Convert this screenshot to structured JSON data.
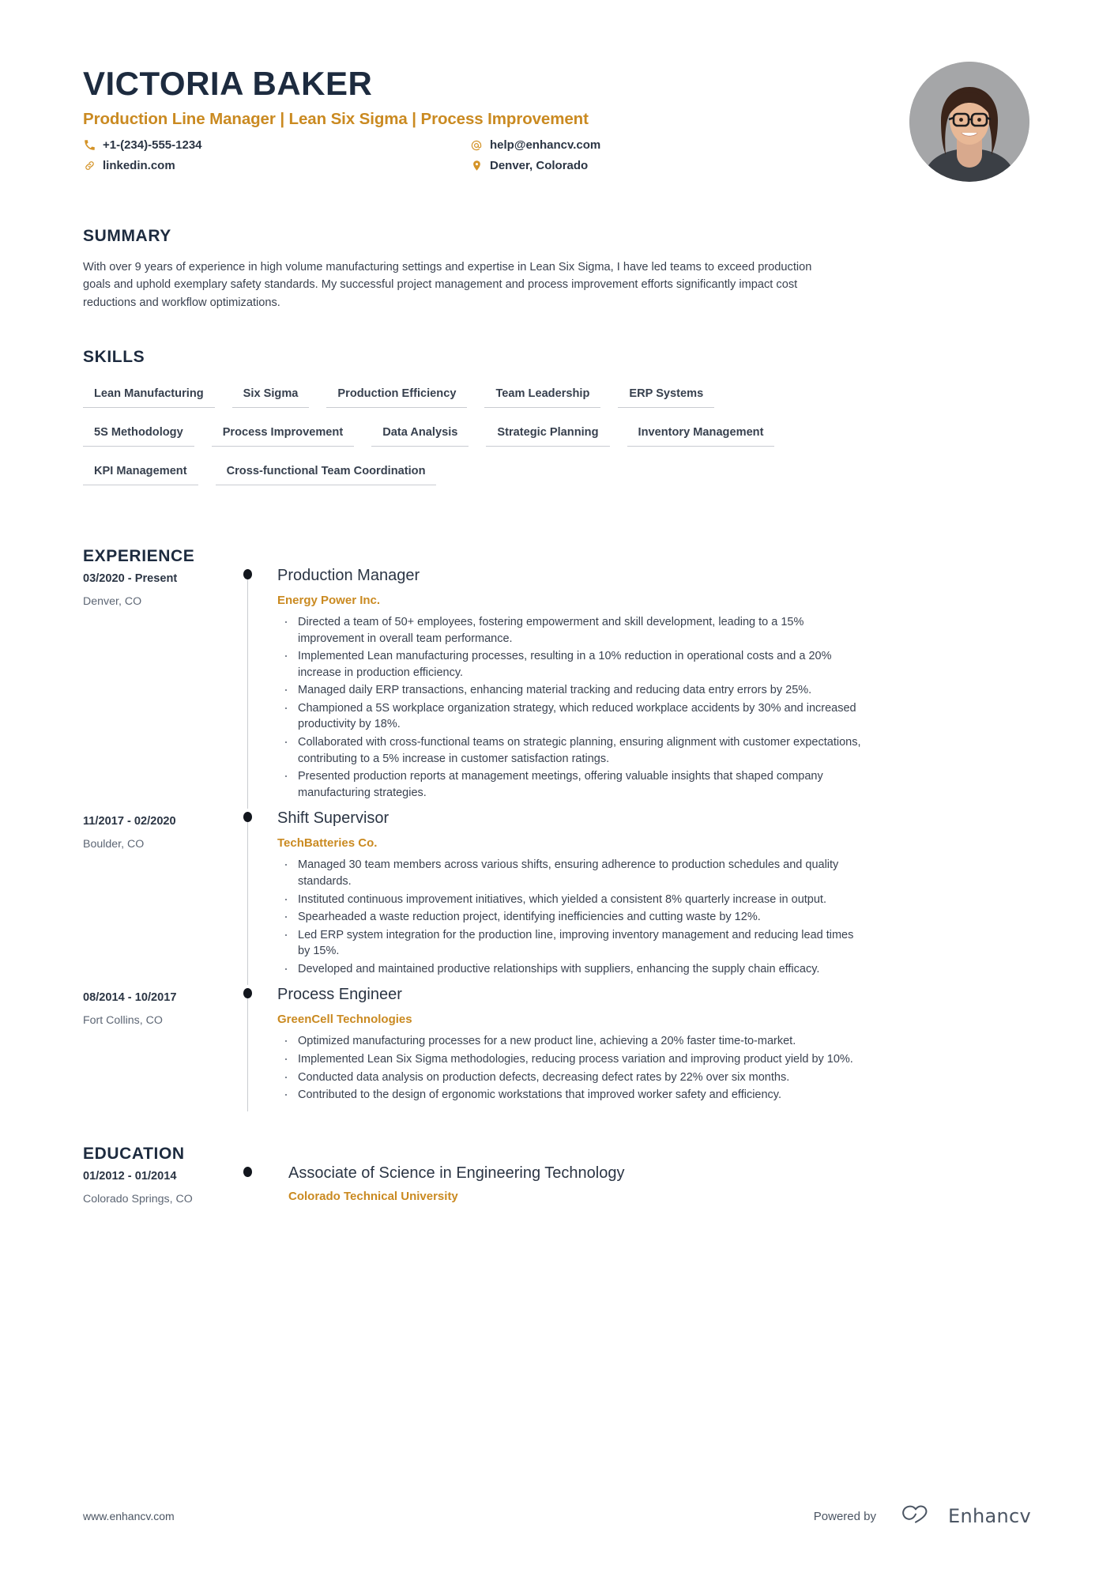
{
  "header": {
    "full_name": "VICTORIA BAKER",
    "job_title": "Production Line Manager | Lean Six Sigma | Process Improvement",
    "contacts": [
      {
        "icon": "phone-icon",
        "value": "+1-(234)-555-1234"
      },
      {
        "icon": "at-sign-icon",
        "value": "help@enhancv.com"
      },
      {
        "icon": "link-icon",
        "value": "linkedin.com"
      },
      {
        "icon": "location-pin-icon",
        "value": "Denver, Colorado"
      }
    ],
    "avatar_alt": "portrait photo"
  },
  "summary": {
    "title": "SUMMARY",
    "text": "With over 9 years of experience in high volume manufacturing settings and expertise in Lean Six Sigma, I have led teams to exceed production goals and uphold exemplary safety standards. My successful project management and process improvement efforts significantly impact cost reductions and workflow optimizations."
  },
  "skills": {
    "title": "SKILLS",
    "items": [
      "Lean Manufacturing",
      "Six Sigma",
      "Production Efficiency",
      "Team Leadership",
      "ERP Systems",
      "5S Methodology",
      "Process Improvement",
      "Data Analysis",
      "Strategic Planning",
      "Inventory Management",
      "KPI Management",
      "Cross-functional Team Coordination"
    ]
  },
  "experience": {
    "title": "EXPERIENCE",
    "entries": [
      {
        "date": "03/2020 - Present",
        "location": "Denver, CO",
        "role": "Production Manager",
        "company": "Energy Power Inc.",
        "bullets": [
          "Directed a team of 50+ employees, fostering empowerment and skill development, leading to a 15% improvement in overall team performance.",
          "Implemented Lean manufacturing processes, resulting in a 10% reduction in operational costs and a 20% increase in production efficiency.",
          "Managed daily ERP transactions, enhancing material tracking and reducing data entry errors by 25%.",
          "Championed a 5S workplace organization strategy, which reduced workplace accidents by 30% and increased productivity by 18%.",
          "Collaborated with cross-functional teams on strategic planning, ensuring alignment with customer expectations, contributing to a 5% increase in customer satisfaction ratings.",
          "Presented production reports at management meetings, offering valuable insights that shaped company manufacturing strategies."
        ]
      },
      {
        "date": "11/2017 - 02/2020",
        "location": "Boulder, CO",
        "role": "Shift Supervisor",
        "company": "TechBatteries Co.",
        "bullets": [
          "Managed 30 team members across various shifts, ensuring adherence to production schedules and quality standards.",
          "Instituted continuous improvement initiatives, which yielded a consistent 8% quarterly increase in output.",
          "Spearheaded a waste reduction project, identifying inefficiencies and cutting waste by 12%.",
          "Led ERP system integration for the production line, improving inventory management and reducing lead times by 15%.",
          "Developed and maintained productive relationships with suppliers, enhancing the supply chain efficacy."
        ]
      },
      {
        "date": "08/2014 - 10/2017",
        "location": "Fort Collins, CO",
        "role": "Process Engineer",
        "company": "GreenCell Technologies",
        "bullets": [
          "Optimized manufacturing processes for a new product line, achieving a 20% faster time-to-market.",
          "Implemented Lean Six Sigma methodologies, reducing process variation and improving product yield by 10%.",
          "Conducted data analysis on production defects, decreasing defect rates by 22% over six months.",
          "Contributed to the design of ergonomic workstations that improved worker safety and efficiency."
        ]
      }
    ]
  },
  "education": {
    "title": "EDUCATION",
    "entries": [
      {
        "date": "01/2012 - 01/2014",
        "location": "Colorado Springs, CO",
        "degree": "Associate of Science in Engineering Technology",
        "school": "Colorado Technical University"
      }
    ]
  },
  "footer": {
    "url": "www.enhancv.com",
    "powered_by": "Powered by",
    "brand": "Enhancv",
    "brand_icon": "enhancv-infinity-logo"
  },
  "colors": {
    "accent_gold": "#ca8a21",
    "heading_navy": "#1d2b3f",
    "body_text": "#3a4250",
    "rule": "#c9ccd1"
  }
}
